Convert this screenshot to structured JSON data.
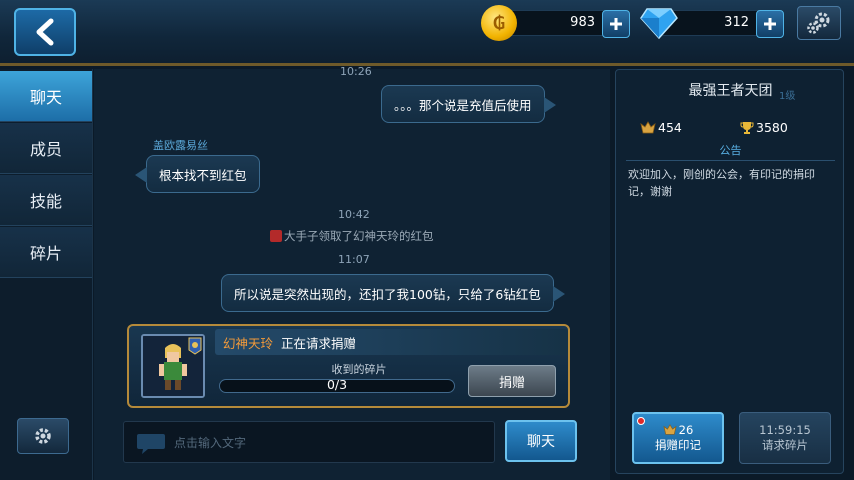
{
  "currency": {
    "gold": "983",
    "gems": "312"
  },
  "sidebar": {
    "tabs": [
      "聊天",
      "成员",
      "技能",
      "碎片"
    ]
  },
  "chat": {
    "messages": [
      {
        "time": "10:26"
      },
      {
        "text": "。。。那个说是充值后使用"
      },
      {
        "sender": "盖欧露易丝",
        "text": "根本找不到红包"
      },
      {
        "time": "10:42"
      },
      {
        "system": "大手子领取了幻神天玲的红包"
      },
      {
        "time": "11:07"
      },
      {
        "text": "所以说是突然出现的，还扣了我100钻，只给了6钻红包"
      }
    ],
    "donation": {
      "name": "幻神天玲",
      "status": "正在请求捐赠",
      "frag_label": "收到的碎片",
      "progress_text": "0/3",
      "progress_fraction": 0,
      "button": "捐赠"
    },
    "input_placeholder": "点击输入文字",
    "send_label": "聊天"
  },
  "guild": {
    "name": "最强王者天团",
    "level": "1级",
    "stat1": "454",
    "stat2": "3580",
    "notice_title": "公告",
    "notice_text": "欢迎加入，刚创的公会，有印记的捐印记，谢谢",
    "mark_count": "26",
    "mark_label": "捐赠印记",
    "timer": "11:59:15",
    "request_label": "请求碎片"
  }
}
